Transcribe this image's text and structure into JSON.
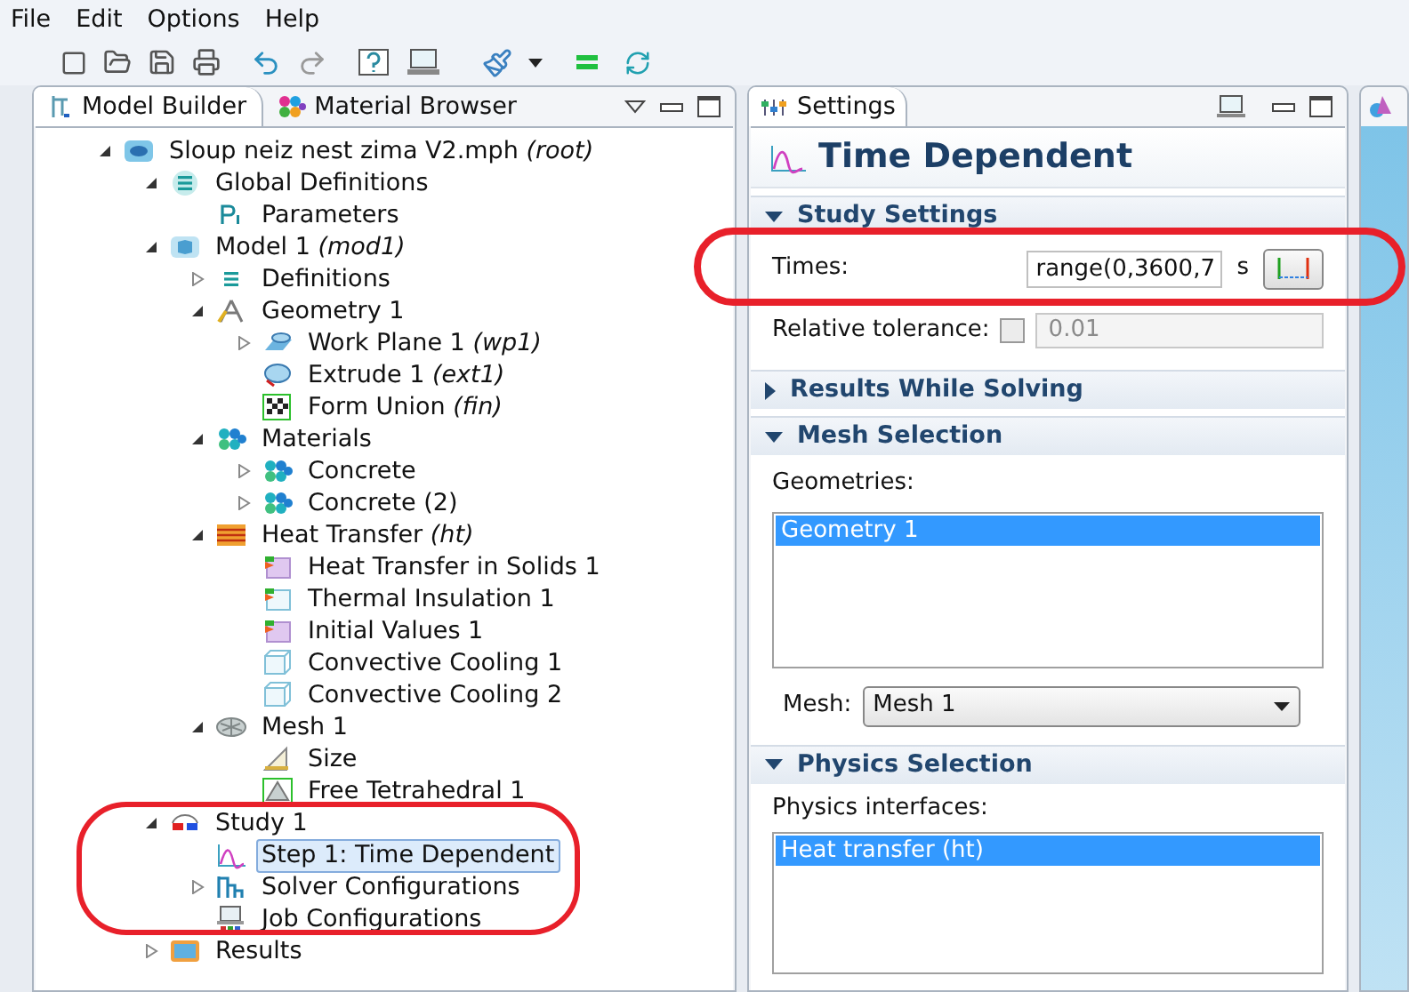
{
  "menu": [
    "File",
    "Edit",
    "Options",
    "Help"
  ],
  "left_tabs": [
    {
      "label": "Model Builder",
      "selected": true
    },
    {
      "label": "Material Browser",
      "selected": false
    }
  ],
  "tree": [
    {
      "label": "Sloup neiz nest zima V2.mph *(root)*",
      "kind": "file",
      "expanded": true,
      "selected": false,
      "children": [
        {
          "label": "Global Definitions",
          "kind": "global",
          "expanded": true,
          "selected": false,
          "children": [
            {
              "label": "Parameters",
              "kind": "parameters",
              "selected": false
            }
          ]
        },
        {
          "label": "Model 1 *(mod1)*",
          "kind": "model",
          "expanded": true,
          "selected": false,
          "children": [
            {
              "label": "Definitions",
              "kind": "definitions",
              "expanded": false,
              "selected": false
            },
            {
              "label": "Geometry 1",
              "kind": "geometry",
              "expanded": true,
              "selected": false,
              "children": [
                {
                  "label": "Work Plane 1 *(wp1)*",
                  "kind": "workplane",
                  "expanded": false,
                  "selected": false
                },
                {
                  "label": "Extrude 1 *(ext1)*",
                  "kind": "extrude",
                  "selected": false
                },
                {
                  "label": "Form Union *(fin)*",
                  "kind": "union",
                  "selected": false
                }
              ]
            },
            {
              "label": "Materials",
              "kind": "materials",
              "expanded": true,
              "selected": false,
              "children": [
                {
                  "label": "Concrete",
                  "kind": "materials",
                  "expanded": false,
                  "selected": false
                },
                {
                  "label": "Concrete (2)",
                  "kind": "materials",
                  "expanded": false,
                  "selected": false
                }
              ]
            },
            {
              "label": "Heat Transfer *(ht)*",
              "kind": "physics",
              "expanded": true,
              "selected": false,
              "children": [
                {
                  "label": "Heat Transfer in Solids 1",
                  "kind": "feature",
                  "selected": false
                },
                {
                  "label": "Thermal Insulation 1",
                  "kind": "feature-outline",
                  "selected": false
                },
                {
                  "label": "Initial Values 1",
                  "kind": "feature",
                  "selected": false
                },
                {
                  "label": "Convective Cooling 1",
                  "kind": "box",
                  "selected": false
                },
                {
                  "label": "Convective Cooling 2",
                  "kind": "box",
                  "selected": false
                }
              ]
            },
            {
              "label": "Mesh 1",
              "kind": "mesh",
              "expanded": true,
              "selected": false,
              "children": [
                {
                  "label": "Size",
                  "kind": "size",
                  "selected": false
                },
                {
                  "label": "Free Tetrahedral 1",
                  "kind": "tetra",
                  "selected": false
                }
              ]
            }
          ]
        },
        {
          "label": "Study 1",
          "kind": "study",
          "expanded": true,
          "selected": false,
          "children": [
            {
              "label": "Step 1: Time Dependent",
              "kind": "step",
              "selected": true
            },
            {
              "label": "Solver Configurations",
              "kind": "solver",
              "expanded": false,
              "selected": false
            },
            {
              "label": "Job Configurations",
              "kind": "job",
              "selected": false
            }
          ]
        },
        {
          "label": "Results",
          "kind": "results",
          "expanded": false,
          "selected": false
        }
      ]
    }
  ],
  "settings": {
    "tab": "Settings",
    "title": "Time Dependent",
    "sections": [
      {
        "title": "Study Settings",
        "expanded": true,
        "kind": "study"
      },
      {
        "title": "Results While Solving",
        "expanded": false,
        "kind": "empty"
      },
      {
        "title": "Mesh Selection",
        "expanded": true,
        "kind": "mesh"
      },
      {
        "title": "Physics Selection",
        "expanded": true,
        "kind": "physics"
      }
    ],
    "times": {
      "label": "Times:",
      "value": "range(0,3600,7",
      "unit": "s"
    },
    "tolerance": {
      "label": "Relative tolerance:",
      "checked": false,
      "value": "0.01",
      "disabled": true
    },
    "geometries": {
      "label": "Geometries:",
      "items": [
        {
          "label": "Geometry 1",
          "selected": true
        }
      ]
    },
    "mesh": {
      "label": "Mesh:",
      "value": "Mesh 1"
    },
    "physics": {
      "label": "Physics interfaces:",
      "items": [
        {
          "label": "Heat transfer (ht)",
          "selected": true
        }
      ]
    }
  }
}
